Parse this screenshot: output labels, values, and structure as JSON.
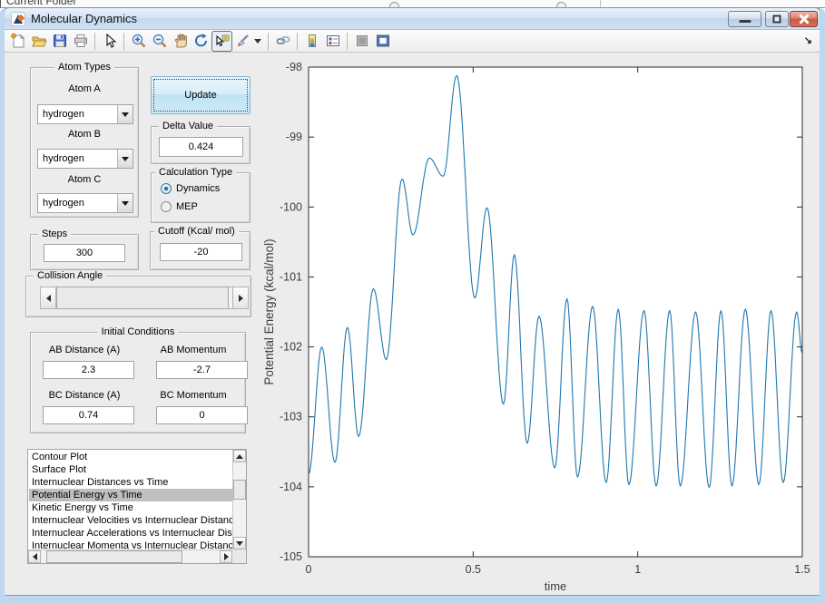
{
  "desktop": {
    "panel_title": "Current Folder"
  },
  "window": {
    "title": "Molecular Dynamics"
  },
  "toolbar": {
    "icons": [
      "new-document",
      "open-folder",
      "save",
      "print",
      "arrow-cursor",
      "zoom-in",
      "zoom-out",
      "pan-hand",
      "rotate-3d",
      "data-cursor",
      "brush",
      "link-plot",
      "insert-colorbar",
      "insert-legend",
      "hide-plot-tools",
      "show-plot-tools-dock-figure"
    ],
    "selected_icon": "data-cursor"
  },
  "panels": {
    "atom_types": {
      "title": "Atom Types",
      "fields": [
        {
          "label": "Atom A",
          "value": "hydrogen"
        },
        {
          "label": "Atom B",
          "value": "hydrogen"
        },
        {
          "label": "Atom C",
          "value": "hydrogen"
        }
      ]
    },
    "update_label": "Update",
    "delta": {
      "title": "Delta Value",
      "value": "0.424"
    },
    "calculation": {
      "title": "Calculation Type",
      "options": [
        {
          "label": "Dynamics",
          "selected": true
        },
        {
          "label": "MEP",
          "selected": false
        }
      ]
    },
    "steps": {
      "title": "Steps",
      "value": "300"
    },
    "cutoff": {
      "title": "Cutoff (Kcal/ mol)",
      "value": "-20"
    },
    "collision_angle": {
      "title": "Collision Angle"
    },
    "initial_conditions": {
      "title": "Initial Conditions",
      "fields": [
        {
          "label": "AB Distance (A)",
          "value": "2.3"
        },
        {
          "label": "AB Momentum",
          "value": "-2.7"
        },
        {
          "label": "BC Distance (A)",
          "value": "0.74"
        },
        {
          "label": "BC Momentum",
          "value": "0"
        }
      ]
    },
    "plot_list": {
      "items": [
        "Contour Plot",
        "Surface Plot",
        "Internuclear Distances vs Time",
        "Potential Energy vs Time",
        "Kinetic Energy vs Time",
        "Internuclear Velocities vs Internuclear Distance",
        "Internuclear Accelerations vs Internuclear Distance",
        "Internuclear Momenta vs Internuclear Distance"
      ],
      "selected_index": 3
    }
  },
  "chart_data": {
    "type": "line",
    "xlabel": "time",
    "ylabel": "Potential Energy (kcal/mol)",
    "xlim": [
      0,
      1.5
    ],
    "ylim": [
      -105,
      -98
    ],
    "xticks": [
      0,
      0.5,
      1,
      1.5
    ],
    "yticks": [
      -105,
      -104,
      -103,
      -102,
      -101,
      -100,
      -99,
      -98
    ],
    "grid": false,
    "box": true,
    "line_color": "#1f77b0",
    "series": [
      {
        "name": "potential-energy",
        "extrema_points": [
          [
            0.0,
            -103.82
          ],
          [
            0.04,
            -102.0
          ],
          [
            0.08,
            -103.65
          ],
          [
            0.118,
            -101.72
          ],
          [
            0.152,
            -103.28
          ],
          [
            0.197,
            -101.17
          ],
          [
            0.236,
            -102.18
          ],
          [
            0.284,
            -99.6
          ],
          [
            0.317,
            -100.4
          ],
          [
            0.367,
            -99.3
          ],
          [
            0.409,
            -99.56
          ],
          [
            0.45,
            -98.12
          ],
          [
            0.505,
            -101.3
          ],
          [
            0.542,
            -100.01
          ],
          [
            0.592,
            -102.82
          ],
          [
            0.625,
            -100.68
          ],
          [
            0.664,
            -103.38
          ],
          [
            0.7,
            -101.56
          ],
          [
            0.748,
            -103.73
          ],
          [
            0.785,
            -101.31
          ],
          [
            0.817,
            -103.86
          ],
          [
            0.863,
            -101.42
          ],
          [
            0.904,
            -103.94
          ],
          [
            0.941,
            -101.46
          ],
          [
            0.973,
            -103.97
          ],
          [
            1.019,
            -101.48
          ],
          [
            1.056,
            -103.99
          ],
          [
            1.097,
            -101.48
          ],
          [
            1.129,
            -103.99
          ],
          [
            1.176,
            -101.5
          ],
          [
            1.217,
            -104.01
          ],
          [
            1.253,
            -101.48
          ],
          [
            1.286,
            -103.99
          ],
          [
            1.327,
            -101.46
          ],
          [
            1.368,
            -103.97
          ],
          [
            1.405,
            -101.48
          ],
          [
            1.442,
            -103.94
          ],
          [
            1.483,
            -101.5
          ],
          [
            1.5,
            -102.1
          ]
        ]
      }
    ]
  }
}
